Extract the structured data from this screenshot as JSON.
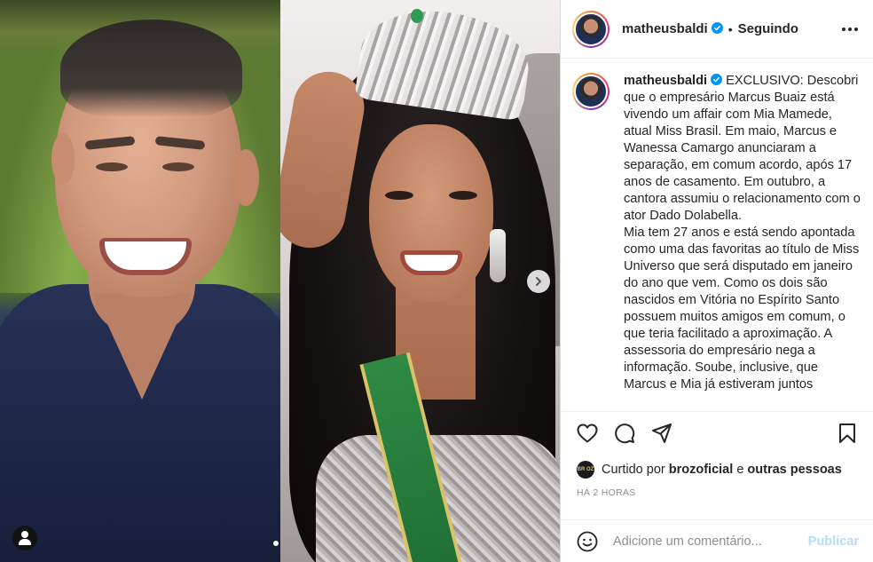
{
  "post": {
    "author": "matheusbaldi",
    "follow_status": "Seguindo",
    "separator": "•",
    "caption": "EXCLUSIVO: Descobri que o empresário Marcus Buaiz está vivendo um affair com Mia Mamede, atual Miss Brasil. Em maio, Marcus e Wanessa Camargo anunciaram a separação, em comum acordo, após 17 anos de casamento. Em outubro, a cantora assumiu o relacionamento com o ator Dado Dolabella.\nMia tem 27 anos e está sendo apontada como uma das favoritas ao título de Miss Universo que será disputado em janeiro do ano que vem. Como os dois são nascidos em Vitória no Espírito Santo possuem muitos amigos em comum, o que teria facilitado a aproximação. A assessoria do empresário nega a informação. Soube, inclusive, que Marcus e Mia já estiveram juntos"
  },
  "likes": {
    "prefix": "Curtido por",
    "user": "brozoficial",
    "joiner": "e",
    "others": "outras pessoas",
    "liker_avatar_text": "BR OZ"
  },
  "timestamp": "HÁ 2 HORAS",
  "comment": {
    "placeholder": "Adicione um comentário...",
    "publish_label": "Publicar"
  },
  "colors": {
    "verified": "#0095f6",
    "publish_disabled": "#b3dbff",
    "text": "#262626",
    "muted": "#8e8e8e"
  },
  "icons": [
    "heart-icon",
    "comment-icon",
    "share-icon",
    "bookmark-icon",
    "emoji-icon",
    "more-icon",
    "chevron-right-icon",
    "user-tag-icon",
    "verified-icon"
  ]
}
